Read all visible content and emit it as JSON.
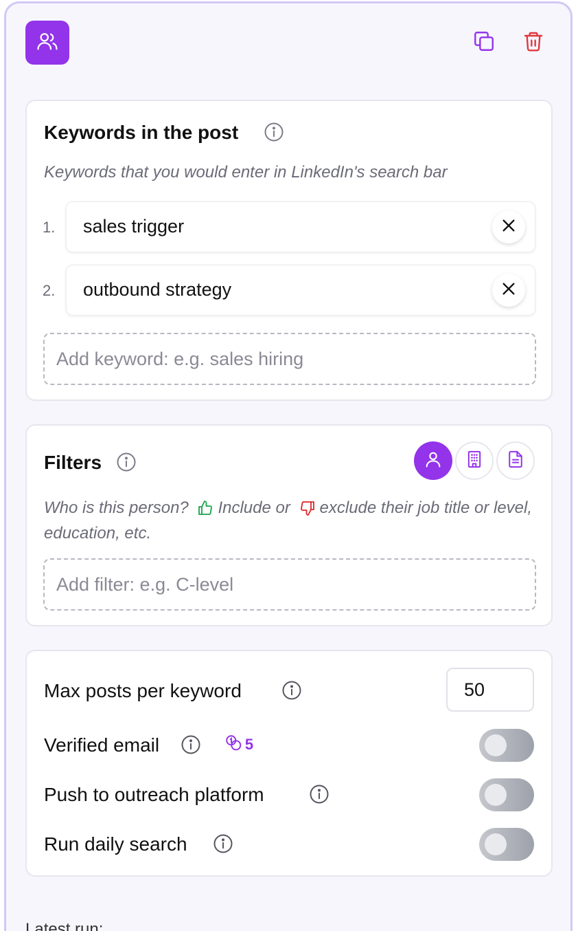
{
  "keywords_section": {
    "title": "Keywords in the post",
    "hint": "Keywords that you would enter in LinkedIn's search bar",
    "items": [
      {
        "num": "1.",
        "text": "sales trigger"
      },
      {
        "num": "2.",
        "text": "outbound strategy"
      }
    ],
    "add_placeholder": "Add keyword: e.g. sales hiring"
  },
  "filters_section": {
    "title": "Filters",
    "hint_part1": "Who is this person?",
    "hint_include": "Include or",
    "hint_exclude": "exclude their job title or level, education, etc.",
    "add_placeholder": "Add filter: e.g. C-level"
  },
  "settings_section": {
    "max_posts_label": "Max posts per keyword",
    "max_posts_value": "50",
    "verified_email_label": "Verified email",
    "verified_email_credits": "5",
    "verified_email_on": false,
    "push_label": "Push to outreach platform",
    "push_on": false,
    "daily_label": "Run daily search",
    "daily_on": false
  },
  "footer": {
    "latest_run_label": "Latest run:"
  },
  "colors": {
    "accent": "#9333ea",
    "danger": "#e0383e",
    "include": "#16a34a",
    "exclude": "#dc2626"
  }
}
